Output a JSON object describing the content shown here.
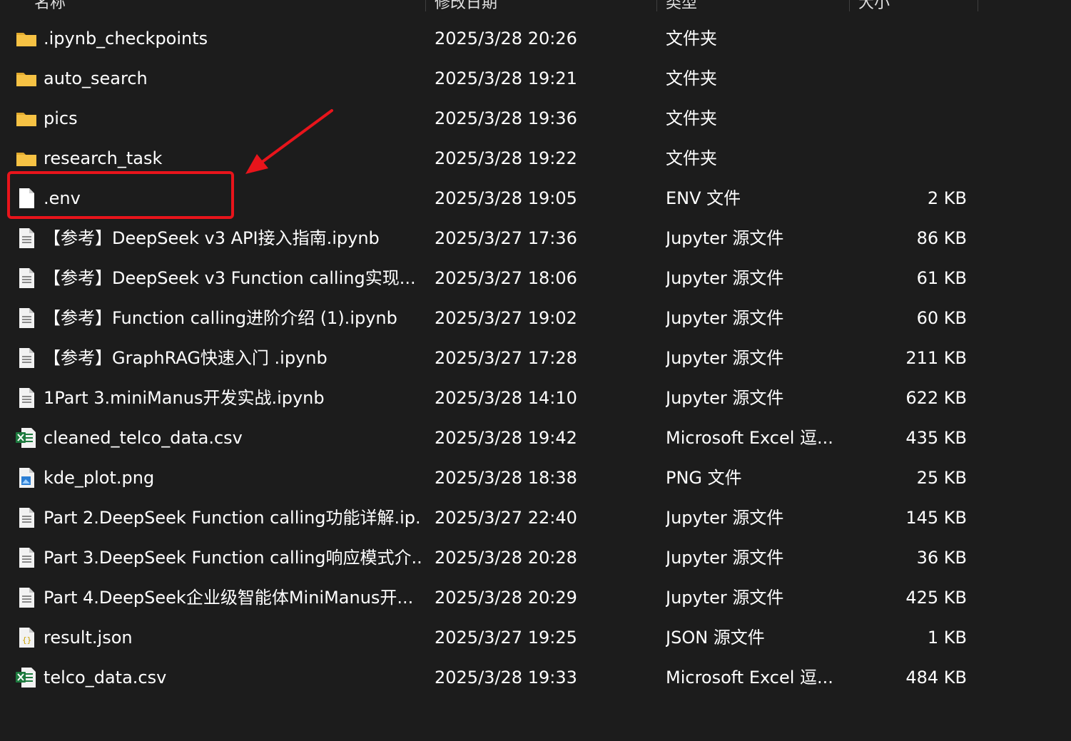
{
  "columns": {
    "name": "名称",
    "date": "修改日期",
    "type": "类型",
    "size": "大小"
  },
  "colors": {
    "background": "#1c1c1c",
    "folder": "#f6c244",
    "highlight": "#e8141b",
    "excel": "#1d7a3e"
  },
  "files": [
    {
      "name": ".ipynb_checkpoints",
      "date": "2025/3/28 20:26",
      "type": "文件夹",
      "size": "",
      "icon": "folder-icon"
    },
    {
      "name": "auto_search",
      "date": "2025/3/28 19:21",
      "type": "文件夹",
      "size": "",
      "icon": "folder-icon"
    },
    {
      "name": "pics",
      "date": "2025/3/28 19:36",
      "type": "文件夹",
      "size": "",
      "icon": "folder-icon"
    },
    {
      "name": "research_task",
      "date": "2025/3/28 19:22",
      "type": "文件夹",
      "size": "",
      "icon": "folder-icon"
    },
    {
      "name": ".env",
      "date": "2025/3/28 19:05",
      "type": "ENV 文件",
      "size": "2 KB",
      "icon": "blank-file-icon"
    },
    {
      "name": "【参考】DeepSeek v3 API接入指南.ipynb",
      "date": "2025/3/27 17:36",
      "type": "Jupyter 源文件",
      "size": "86 KB",
      "icon": "document-file-icon"
    },
    {
      "name": "【参考】DeepSeek v3 Function calling实现...",
      "date": "2025/3/27 18:06",
      "type": "Jupyter 源文件",
      "size": "61 KB",
      "icon": "document-file-icon"
    },
    {
      "name": "【参考】Function calling进阶介绍 (1).ipynb",
      "date": "2025/3/27 19:02",
      "type": "Jupyter 源文件",
      "size": "60 KB",
      "icon": "document-file-icon"
    },
    {
      "name": "【参考】GraphRAG快速入门 .ipynb",
      "date": "2025/3/27 17:28",
      "type": "Jupyter 源文件",
      "size": "211 KB",
      "icon": "document-file-icon"
    },
    {
      "name": "1Part 3.miniManus开发实战.ipynb",
      "date": "2025/3/28 14:10",
      "type": "Jupyter 源文件",
      "size": "622 KB",
      "icon": "document-file-icon"
    },
    {
      "name": "cleaned_telco_data.csv",
      "date": "2025/3/28 19:42",
      "type": "Microsoft Excel 逗...",
      "size": "435 KB",
      "icon": "excel-file-icon"
    },
    {
      "name": "kde_plot.png",
      "date": "2025/3/28 18:38",
      "type": "PNG 文件",
      "size": "25 KB",
      "icon": "image-file-icon"
    },
    {
      "name": "Part 2.DeepSeek Function calling功能详解.ip...",
      "date": "2025/3/27 22:40",
      "type": "Jupyter 源文件",
      "size": "145 KB",
      "icon": "document-file-icon"
    },
    {
      "name": "Part 3.DeepSeek Function calling响应模式介...",
      "date": "2025/3/28 20:28",
      "type": "Jupyter 源文件",
      "size": "36 KB",
      "icon": "document-file-icon"
    },
    {
      "name": "Part 4.DeepSeek企业级智能体MiniManus开...",
      "date": "2025/3/28 20:29",
      "type": "Jupyter 源文件",
      "size": "425 KB",
      "icon": "document-file-icon"
    },
    {
      "name": "result.json",
      "date": "2025/3/27 19:25",
      "type": "JSON 源文件",
      "size": "1 KB",
      "icon": "json-file-icon"
    },
    {
      "name": "telco_data.csv",
      "date": "2025/3/28 19:33",
      "type": "Microsoft Excel 逗...",
      "size": "484 KB",
      "icon": "excel-file-icon"
    }
  ]
}
